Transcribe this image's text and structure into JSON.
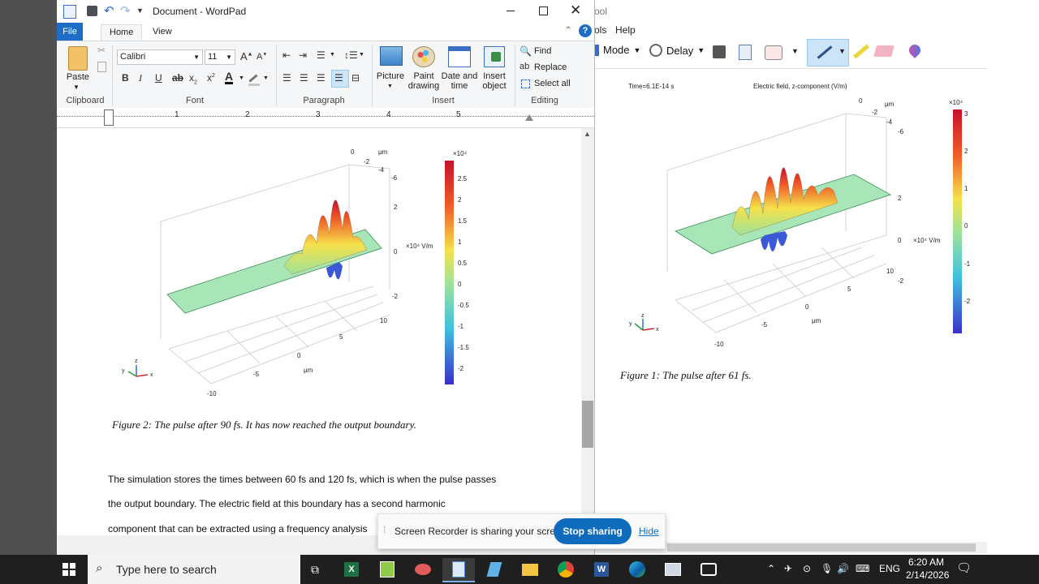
{
  "wordpad": {
    "title": "Document - WordPad",
    "tabs": [
      "File",
      "Home",
      "View"
    ],
    "clipboard": {
      "paste": "Paste",
      "group": "Clipboard"
    },
    "font": {
      "family": "Calibri",
      "size": "11",
      "group": "Font"
    },
    "paragraph": {
      "group": "Paragraph"
    },
    "insert": {
      "picture": "Picture",
      "paint": "Paint drawing",
      "paint_line1": "Paint",
      "paint_line2": "drawing",
      "datetime_line1": "Date and",
      "datetime_line2": "time",
      "object_line1": "Insert",
      "object_line2": "object",
      "group": "Insert"
    },
    "editing": {
      "find": "Find",
      "replace": "Replace",
      "select_all": "Select all",
      "group": "Editing"
    },
    "ruler_numbers": [
      "1",
      "2",
      "3",
      "4",
      "5"
    ],
    "figure": {
      "colorbar_exp": "×10⁴",
      "colorbar_ticks": [
        "2.5",
        "2",
        "1.5",
        "1",
        "0.5",
        "0",
        "-0.5",
        "-1",
        "-1.5",
        "-2"
      ],
      "axis_unit": "×10⁴ V/m",
      "z_ticks": [
        "2",
        "0",
        "-2"
      ],
      "top_ticks": [
        "0",
        "-2",
        "-4",
        "-6"
      ],
      "top_unit": "μm",
      "x_ticks": [
        "10",
        "5",
        "0",
        "-5",
        "-10"
      ],
      "x_unit": "μm",
      "caption": "Figure 2: The pulse after 90 fs. It has now reached the output boundary."
    },
    "paragraph_lines": [
      "The simulation stores the times between 60 fs and 120 fs, which is when the pulse passes",
      "the output boundary. The electric field at this boundary has a second harmonic",
      "component that can be extracted using a frequency analysis"
    ]
  },
  "snip": {
    "title_fragment": "ool",
    "menu": [
      "ols",
      "Help"
    ],
    "toolbar": {
      "mode": "Mode",
      "delay": "Delay"
    },
    "figure": {
      "time": "Time=6.1E-14 s",
      "title": "Electric field, z-component (V/m)",
      "colorbar_exp": "×10⁴",
      "colorbar_ticks": [
        "3",
        "2",
        "1",
        "0",
        "-1",
        "-2"
      ],
      "axis_unit": "×10⁴ V/m",
      "z_ticks": [
        "2",
        "0",
        "-2"
      ],
      "top_ticks": [
        "0",
        "-2",
        "-4",
        "-6"
      ],
      "top_unit": "μm",
      "x_ticks": [
        "10",
        "5",
        "0",
        "-5",
        "-10"
      ],
      "x_unit": "μm",
      "caption": "Figure 1: The pulse after 61 fs."
    }
  },
  "recorder": {
    "message": "Screen Recorder is sharing your screen.",
    "stop": "Stop sharing",
    "hide": "Hide"
  },
  "taskbar": {
    "search_placeholder": "Type here to search",
    "language": "ENG",
    "time": "6:20 AM",
    "date": "2/14/2026"
  },
  "colors": {
    "accent": "#1e6ec8",
    "stop_button": "#0f6cbd",
    "taskbar": "#1f1f1f",
    "plane": "#a8e6b8"
  }
}
